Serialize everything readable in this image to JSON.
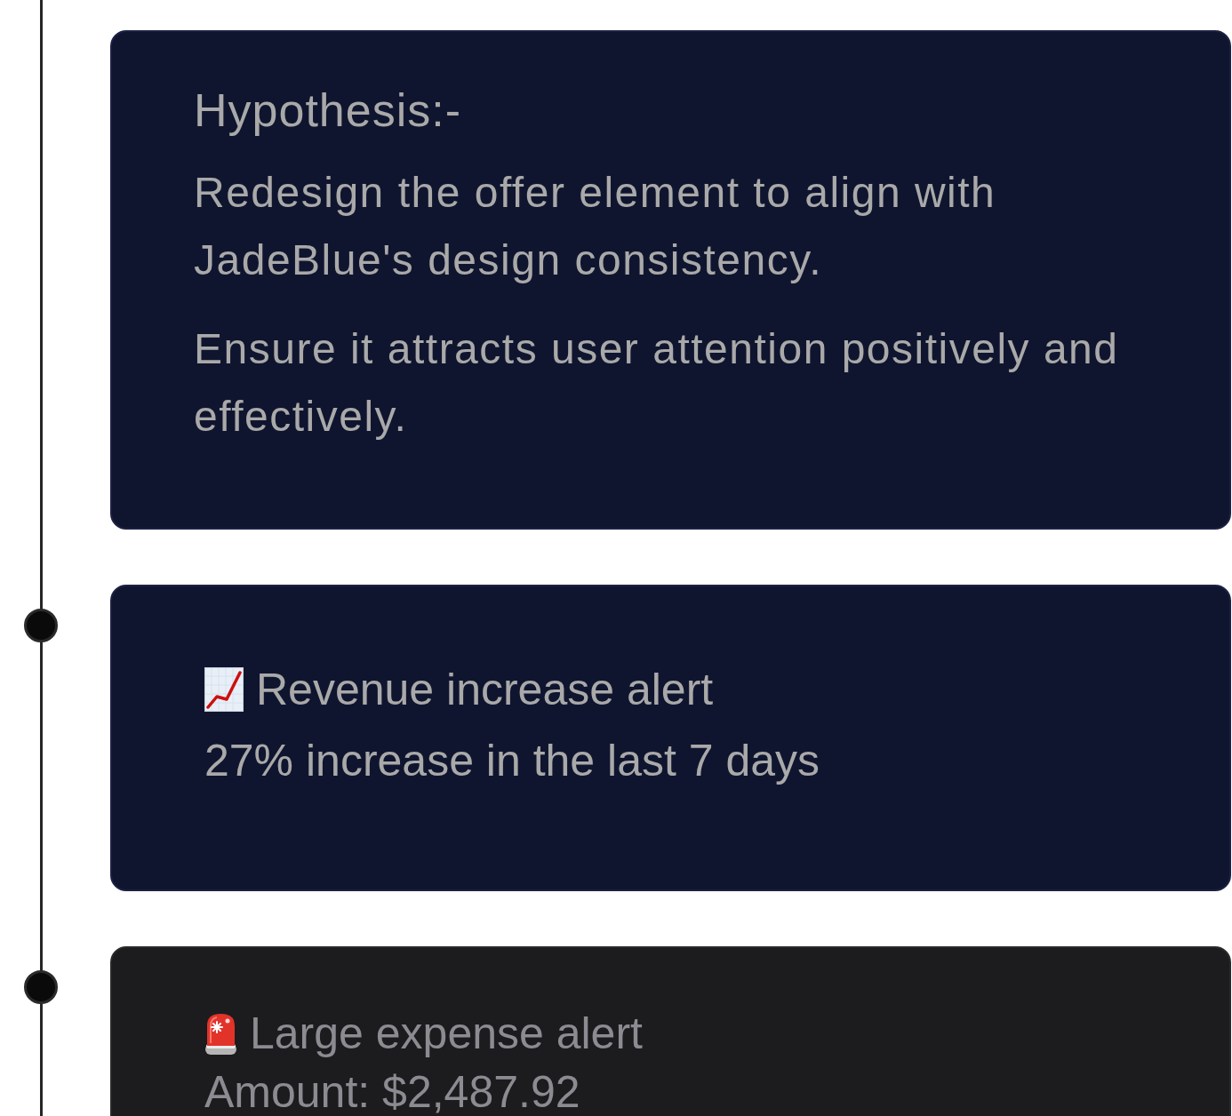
{
  "timeline": [
    {
      "kind": "hypothesis",
      "dot": false,
      "title": "Hypothesis:-",
      "paragraphs": [
        "Redesign the offer element to align with JadeBlue's design consistency.",
        "Ensure it attracts user attention positively and effectively."
      ]
    },
    {
      "kind": "revenue_alert",
      "dot": true,
      "title": "Revenue increase alert",
      "detail": "27% increase in the last 7 days"
    },
    {
      "kind": "expense_alert",
      "dot": true,
      "title": "Large expense alert",
      "detail": "Amount: $2,487.92"
    }
  ]
}
